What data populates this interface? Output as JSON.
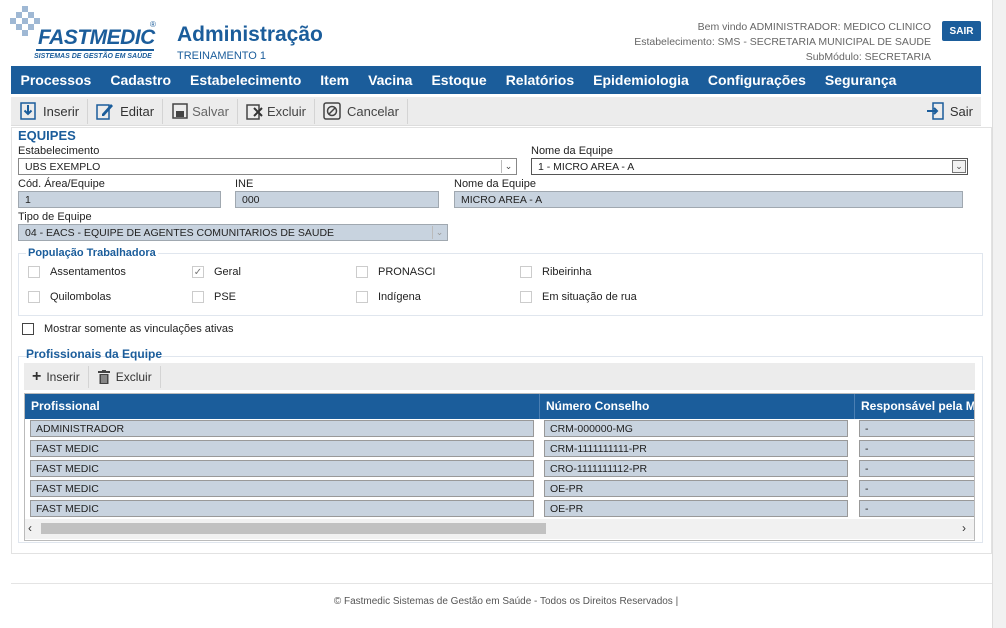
{
  "logo": {
    "brand": "FASTMEDIC",
    "tagline": "SISTEMAS DE GESTÃO EM SAÚDE",
    "reg": "®"
  },
  "header": {
    "title": "Administração",
    "subtitle": "TREINAMENTO 1",
    "welcome": "Bem vindo ADMINISTRADOR: MEDICO CLINICO",
    "establishment": "Estabelecimento: SMS - SECRETARIA MUNICIPAL DE SAUDE",
    "submodule": "SubMódulo: SECRETARIA",
    "logout_label": "SAIR"
  },
  "menu": [
    "Processos",
    "Cadastro",
    "Estabelecimento",
    "Item",
    "Vacina",
    "Estoque",
    "Relatórios",
    "Epidemiologia",
    "Configurações",
    "Segurança"
  ],
  "toolbar": {
    "insert": "Inserir",
    "edit": "Editar",
    "save": "Salvar",
    "delete": "Excluir",
    "cancel": "Cancelar",
    "exit": "Sair"
  },
  "form": {
    "section_title": "EQUIPES",
    "estabelecimento_label": "Estabelecimento",
    "estabelecimento_value": "UBS EXEMPLO",
    "nome_equipe_select_label": "Nome da Equipe",
    "nome_equipe_select_value": "1 - MICRO AREA - A",
    "cod_area_label": "Cód. Área/Equipe",
    "cod_area_value": "1",
    "ine_label": "INE",
    "ine_value": "000",
    "nome_equipe_label": "Nome da Equipe",
    "nome_equipe_value": "MICRO AREA - A",
    "tipo_label": "Tipo de Equipe",
    "tipo_value": "04 - EACS - EQUIPE DE AGENTES COMUNITARIOS DE SAUDE"
  },
  "population": {
    "title": "População Trabalhadora",
    "options": [
      {
        "label": "Assentamentos",
        "checked": false
      },
      {
        "label": "Geral",
        "checked": true
      },
      {
        "label": "PRONASCI",
        "checked": false
      },
      {
        "label": "Ribeirinha",
        "checked": false
      },
      {
        "label": "Quilombolas",
        "checked": false
      },
      {
        "label": "PSE",
        "checked": false
      },
      {
        "label": "Indígena",
        "checked": false
      },
      {
        "label": "Em situação de rua",
        "checked": false
      }
    ]
  },
  "active_only_label": "Mostrar somente as vinculações ativas",
  "professionals": {
    "title": "Profissionais da Equipe",
    "insert_label": "Inserir",
    "delete_label": "Excluir",
    "columns": [
      "Profissional",
      "Número Conselho",
      "Responsável pela M"
    ],
    "rows": [
      [
        "ADMINISTRADOR",
        "CRM-000000-MG",
        "-"
      ],
      [
        "FAST MEDIC",
        "CRM-1111111111-PR",
        "-"
      ],
      [
        "FAST MEDIC",
        "CRO-1111111112-PR",
        "-"
      ],
      [
        "FAST MEDIC",
        "OE-PR",
        "-"
      ],
      [
        "FAST MEDIC",
        "OE-PR",
        "-"
      ]
    ]
  },
  "footer": "© Fastmedic Sistemas de Gestão em Saúde - Todos os Direitos Reservados |"
}
